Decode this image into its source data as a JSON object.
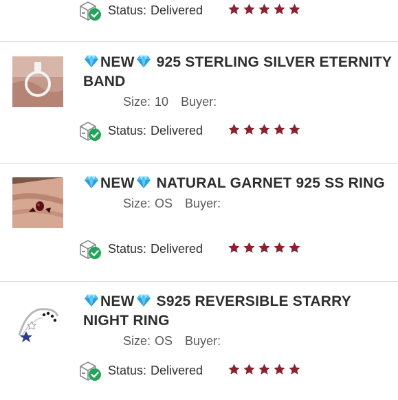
{
  "colors": {
    "star": "#8a2232",
    "check": "#22a55a",
    "divider": "#dcdcdc",
    "gem": "#3db0ea"
  },
  "labels": {
    "status_label": "Status:",
    "size_label": "Size:",
    "buyer_label": "Buyer:",
    "new_badge": "NEW"
  },
  "top_row": {
    "status_value": "Delivered",
    "rating": 5
  },
  "items": [
    {
      "title_rest": "925 STERLING SILVER ETERNITY BAND",
      "size": "10",
      "status_value": "Delivered",
      "rating": 5,
      "thumb_icon": "silver-pendant-ring-photo"
    },
    {
      "title_rest": "NATURAL GARNET 925 SS RING",
      "size": "OS",
      "status_value": "Delivered",
      "rating": 5,
      "thumb_icon": "garnet-ring-on-hand-photo"
    },
    {
      "title_rest": "S925 REVERSIBLE STARRY NIGHT RING",
      "size": "OS",
      "status_value": "Delivered",
      "rating": 5,
      "thumb_icon": "starry-night-ring-photo"
    }
  ]
}
